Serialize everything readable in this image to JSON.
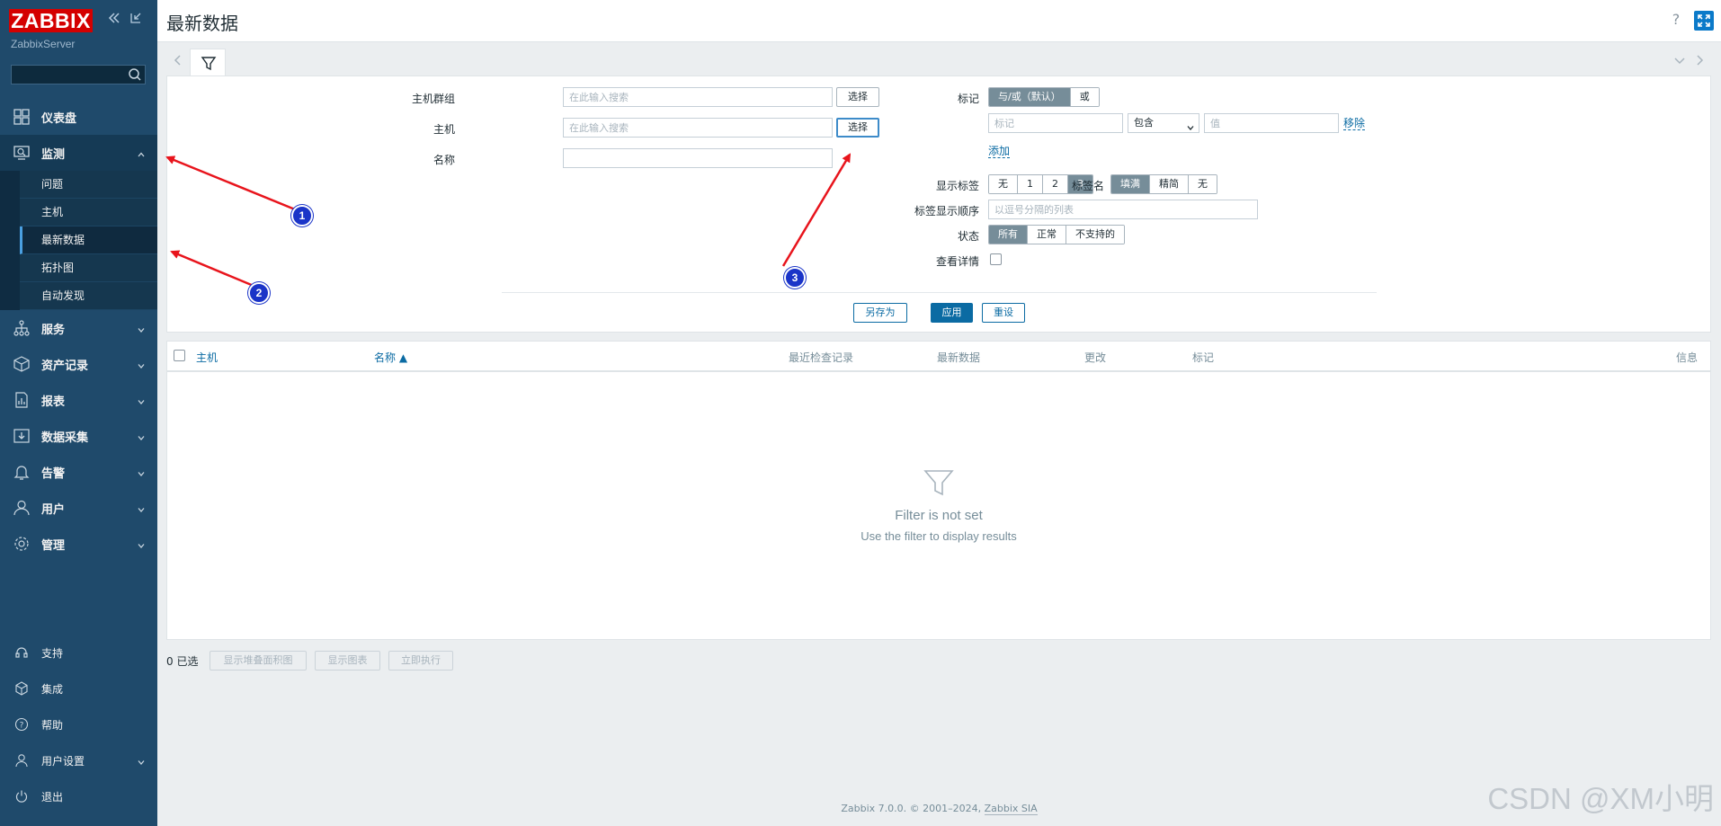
{
  "app": {
    "logo": "ZABBIX",
    "server_name": "ZabbixServer"
  },
  "sidebar": {
    "items": [
      {
        "label": "仪表盘",
        "icon": "dashboard-icon"
      },
      {
        "label": "监测",
        "icon": "monitoring-icon",
        "expanded": true
      },
      {
        "label": "服务",
        "icon": "services-icon"
      },
      {
        "label": "资产记录",
        "icon": "inventory-icon"
      },
      {
        "label": "报表",
        "icon": "reports-icon"
      },
      {
        "label": "数据采集",
        "icon": "data-collection-icon"
      },
      {
        "label": "告警",
        "icon": "alerts-icon"
      },
      {
        "label": "用户",
        "icon": "users-icon"
      },
      {
        "label": "管理",
        "icon": "administration-icon"
      }
    ],
    "monitoring_sub": [
      {
        "label": "问题"
      },
      {
        "label": "主机"
      },
      {
        "label": "最新数据",
        "active": true
      },
      {
        "label": "拓扑图"
      },
      {
        "label": "自动发现"
      }
    ],
    "bottom": [
      {
        "label": "支持"
      },
      {
        "label": "集成"
      },
      {
        "label": "帮助"
      },
      {
        "label": "用户设置"
      },
      {
        "label": "退出"
      }
    ]
  },
  "header": {
    "title": "最新数据",
    "help": "?"
  },
  "filter": {
    "host_groups_label": "主机群组",
    "host_groups_placeholder": "在此输入搜索",
    "hosts_label": "主机",
    "hosts_placeholder": "在此输入搜索",
    "select_label": "选择",
    "name_label": "名称",
    "name_value": "",
    "tags_label": "标记",
    "tags_eval": [
      "与/或（默认）",
      "或"
    ],
    "tag_placeholder": "标记",
    "tag_operator": "包含",
    "tag_value_placeholder": "值",
    "remove_label": "移除",
    "add_label": "添加",
    "show_tags_label": "显示标签",
    "show_tags_options": [
      "无",
      "1",
      "2",
      "3"
    ],
    "tag_name_label": "标签名",
    "tag_name_options": [
      "填满",
      "精简",
      "无"
    ],
    "tag_priority_label": "标签显示顺序",
    "tag_priority_placeholder": "以逗号分隔的列表",
    "state_label": "状态",
    "state_options": [
      "所有",
      "正常",
      "不支持的"
    ],
    "show_details_label": "查看详情",
    "save_as_label": "另存为",
    "apply_label": "应用",
    "reset_label": "重设"
  },
  "table": {
    "columns": [
      "主机",
      "名称 ▲",
      "最近检查记录",
      "最新数据",
      "更改",
      "标记",
      "信息"
    ],
    "empty_title": "Filter is not set",
    "empty_sub": "Use the filter to display results"
  },
  "actions": {
    "selected": "0 已选",
    "buttons": [
      "显示堆叠面积图",
      "显示图表",
      "立即执行"
    ]
  },
  "footer": {
    "text": "Zabbix 7.0.0. © 2001–2024, ",
    "link": "Zabbix SIA"
  },
  "annotations": {
    "badges": [
      "1",
      "2",
      "3"
    ],
    "arrow_color": "#e8141c",
    "badge_color": "#1a34c8"
  },
  "watermark": "CSDN @XM小明"
}
